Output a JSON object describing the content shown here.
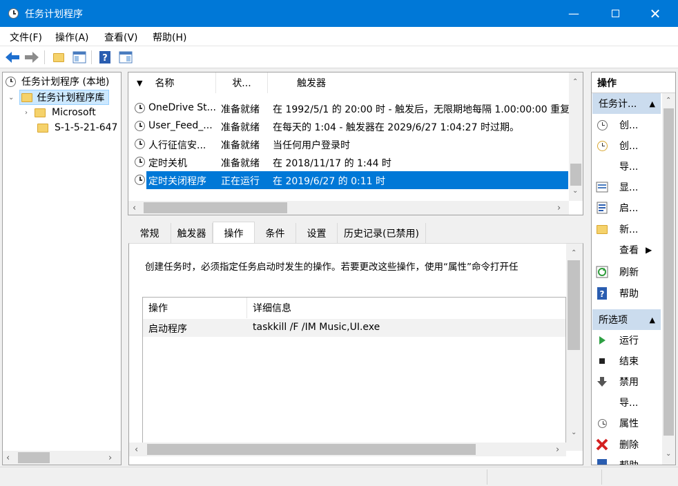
{
  "window": {
    "title": "任务计划程序"
  },
  "menu": [
    "文件(F)",
    "操作(A)",
    "查看(V)",
    "帮助(H)"
  ],
  "tree": {
    "root": "任务计划程序 (本地)",
    "library": "任务计划程序库",
    "children": [
      "Microsoft",
      "S-1-5-21-647"
    ]
  },
  "task_table": {
    "columns": [
      "名称",
      "状...",
      "触发器"
    ],
    "rows": [
      {
        "name": "OneDrive St...",
        "status": "准备就绪",
        "trigger": "在 1992/5/1 的 20:00 时 - 触发后，无限期地每隔 1.00:00:00 重复"
      },
      {
        "name": "User_Feed_...",
        "status": "准备就绪",
        "trigger": "在每天的 1:04 - 触发器在 2029/6/27 1:04:27 时过期。"
      },
      {
        "name": "人行征信安...",
        "status": "准备就绪",
        "trigger": "当任何用户登录时"
      },
      {
        "name": "定时关机",
        "status": "准备就绪",
        "trigger": "在 2018/11/17 的 1:44 时"
      },
      {
        "name": "定时关闭程序",
        "status": "正在运行",
        "trigger": "在 2019/6/27 的 0:11 时"
      }
    ]
  },
  "tabs": [
    "常规",
    "触发器",
    "操作",
    "条件",
    "设置",
    "历史记录(已禁用)"
  ],
  "detail": {
    "description": "创建任务时，必须指定任务启动时发生的操作。若要更改这些操作，使用“属性”命令打开任",
    "columns": [
      "操作",
      "详细信息"
    ],
    "rows": [
      {
        "action": "启动程序",
        "details": "taskkill /F /IM Music,UI.exe"
      }
    ]
  },
  "actions_pane": {
    "title": "操作",
    "section1": "任务计...",
    "items1": [
      "创...",
      "创...",
      "导...",
      "显...",
      "启...",
      "新...",
      "查看",
      "刷新",
      "帮助"
    ],
    "section2": "所选项",
    "items2": [
      "运行",
      "结束",
      "禁用",
      "导...",
      "属性",
      "删除",
      "帮助"
    ]
  }
}
